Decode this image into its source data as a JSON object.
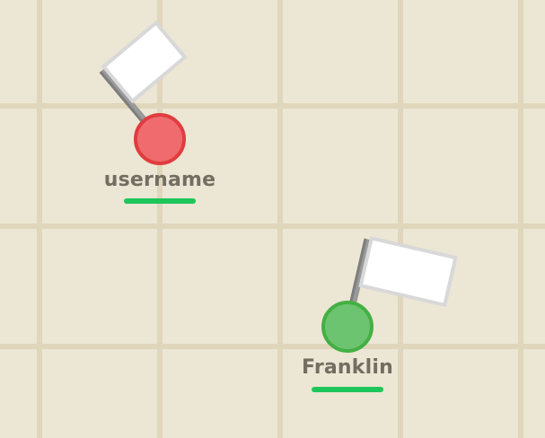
{
  "colors": {
    "background": "#ece6d4",
    "grid_line": "#e0d6bb",
    "name_text": "#736e62",
    "health_bar": "#1dc65a",
    "flag_pole": "#9a9a9a",
    "flag_cloth": "#ffffff",
    "flag_border": "#d8d8d8"
  },
  "players": [
    {
      "name": "username",
      "body_color": "#ef6b6e",
      "body_border": "#e03c3f",
      "health": 1.0
    },
    {
      "name": "Franklin",
      "body_color": "#6cc470",
      "body_border": "#44b044",
      "health": 1.0
    }
  ]
}
